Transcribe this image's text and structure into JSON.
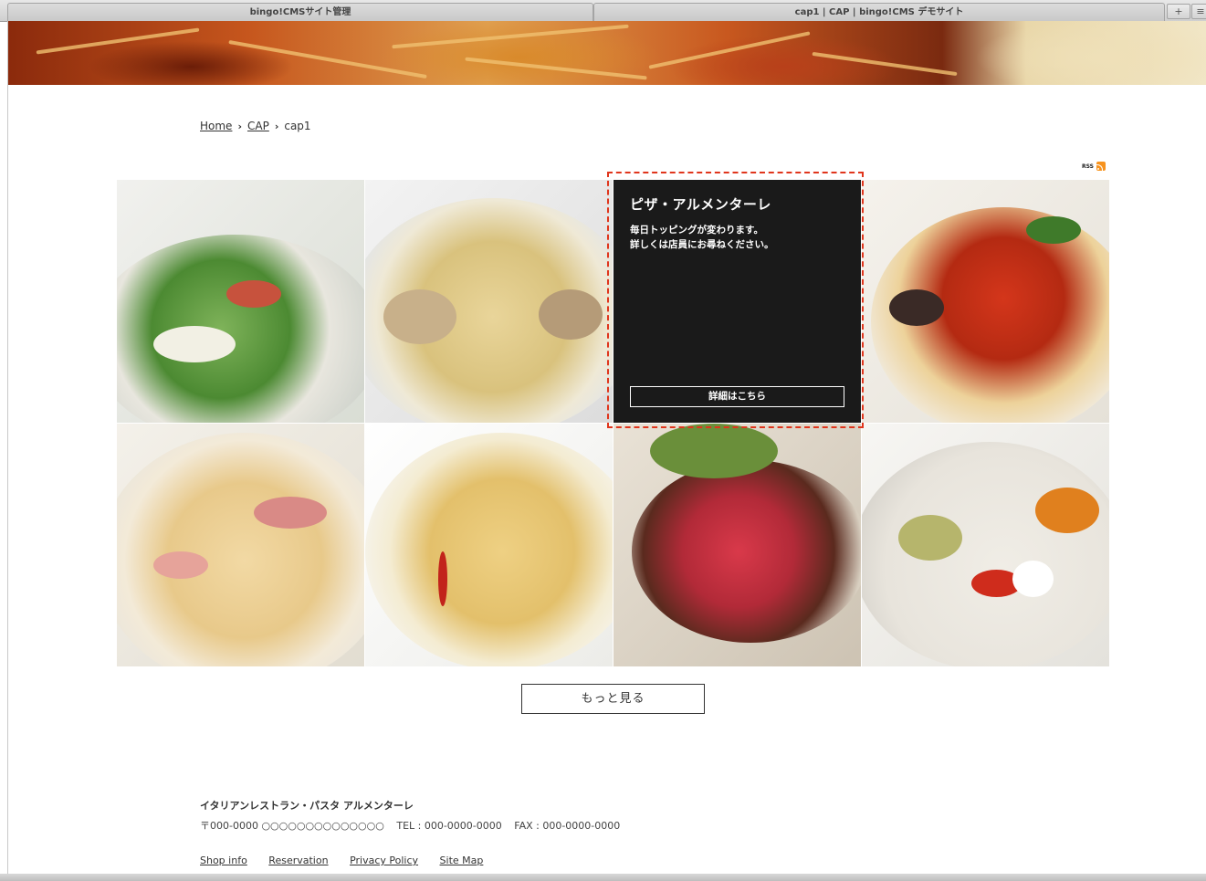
{
  "browser": {
    "tabs": [
      {
        "title": "bingo!CMSサイト管理"
      },
      {
        "title": "cap1 | CAP | bingo!CMS デモサイト"
      }
    ],
    "new_tab_label": "+",
    "tab_list_label": "≡"
  },
  "breadcrumb": {
    "home": "Home",
    "separator": "›",
    "section": "CAP",
    "current": "cap1"
  },
  "rss": {
    "label": "RSS",
    "icon": "rss-icon",
    "color": "#f7931e"
  },
  "gallery": {
    "items": [
      {
        "name": "salad",
        "icon": "salad-photo"
      },
      {
        "name": "vongole",
        "icon": "clam-pasta-photo"
      },
      {
        "name": "pizza",
        "icon": "pizza-photo"
      },
      {
        "name": "eggplant-tomato",
        "icon": "tomato-pasta-photo"
      },
      {
        "name": "carbonara",
        "icon": "cream-pasta-photo"
      },
      {
        "name": "peperoncino",
        "icon": "peperoncino-photo"
      },
      {
        "name": "roast-beef",
        "icon": "roast-beef-photo"
      },
      {
        "name": "antipasto",
        "icon": "antipasto-photo"
      }
    ],
    "overlay": {
      "title": "ピザ・アルメンターレ",
      "line1": "毎日トッピングが変わります。",
      "line2": "詳しくは店員にお尋ねください。",
      "button": "詳細はこちら"
    },
    "highlight_color": "#e0351c"
  },
  "more_button": "もっと見る",
  "footer": {
    "name": "イタリアンレストラン・パスタ アルメンターレ",
    "postal": "〒000-0000 ○○○○○○○○○○○○○○",
    "tel": "TEL : 000-0000-0000",
    "fax": "FAX : 000-0000-0000",
    "links": [
      "Shop info",
      "Reservation",
      "Privacy Policy",
      "Site Map"
    ]
  }
}
